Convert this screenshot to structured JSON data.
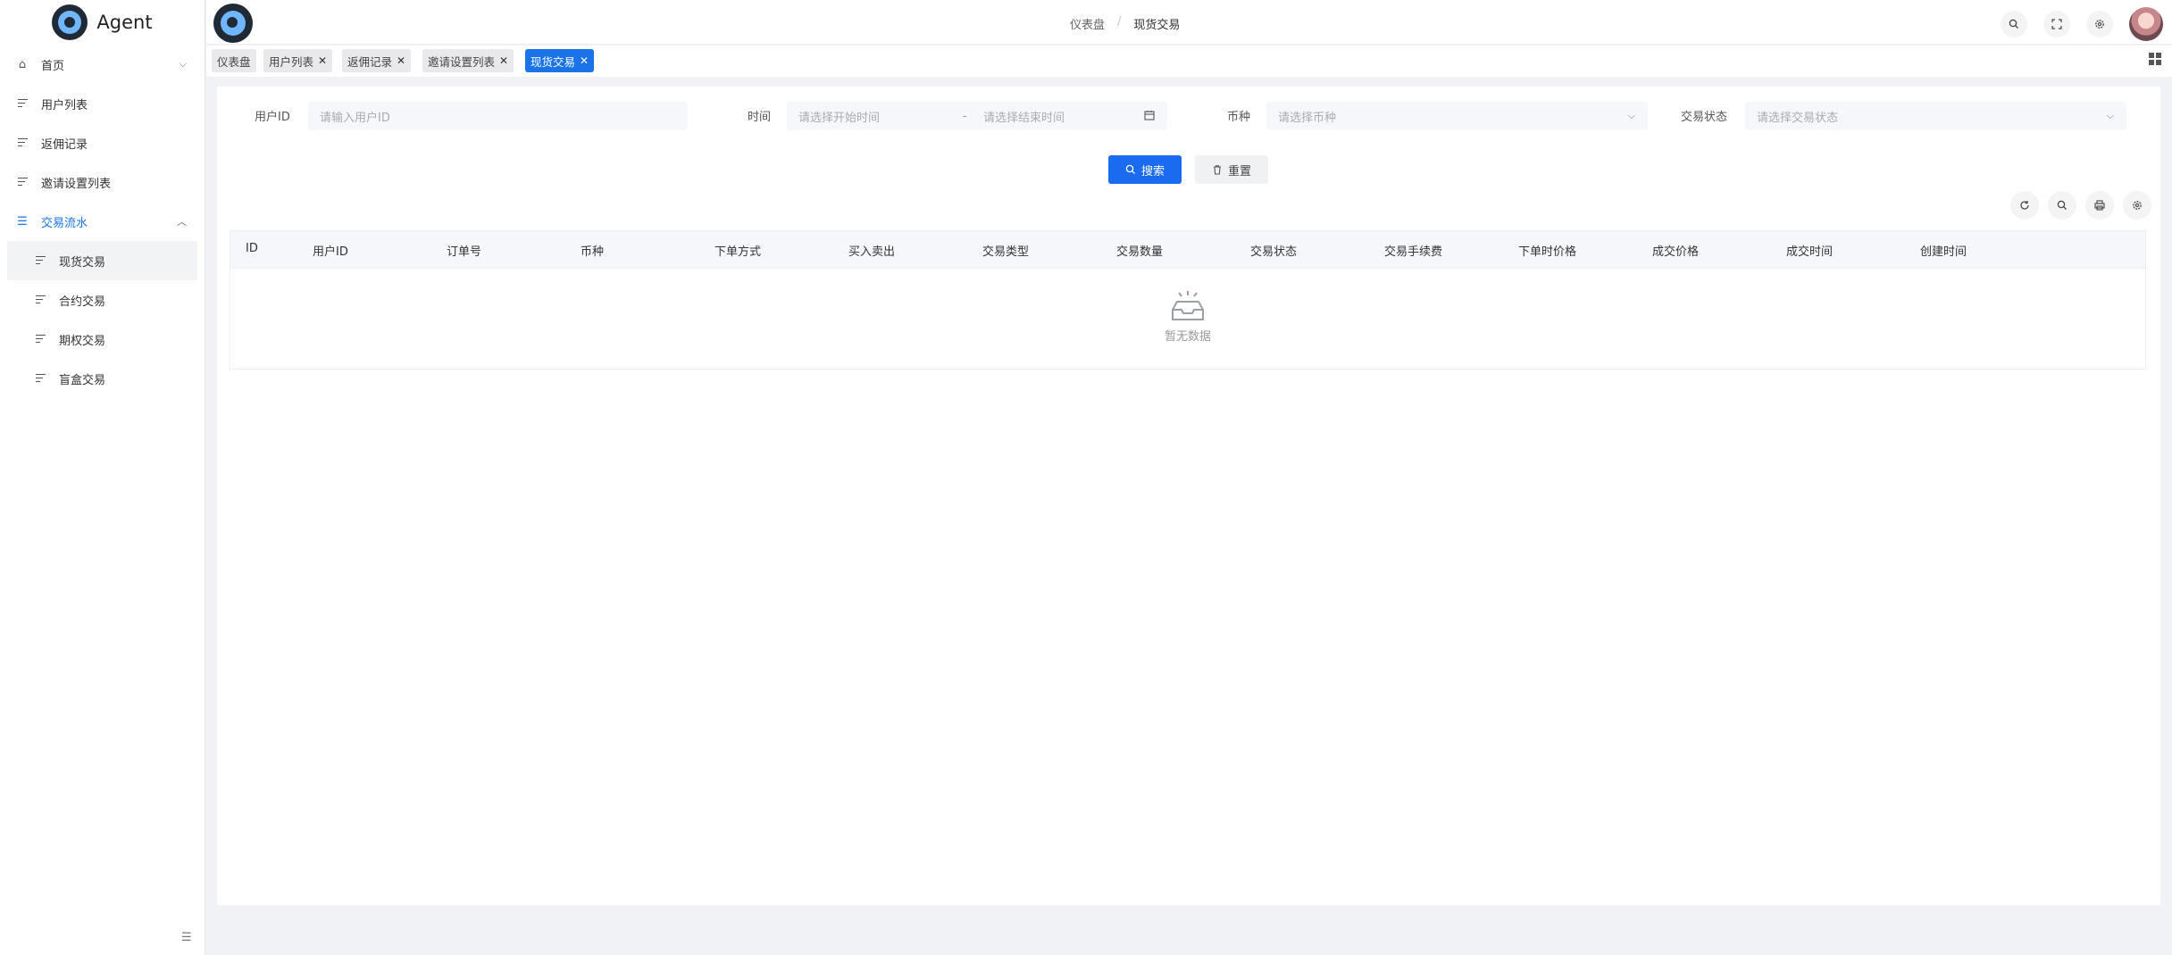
{
  "brand": {
    "name": "Agent"
  },
  "sidebar": {
    "items": [
      {
        "label": "首页",
        "icon": "home-icon",
        "chevron": "⌵"
      },
      {
        "label": "用户列表",
        "icon": "list-icon"
      },
      {
        "label": "返佣记录",
        "icon": "list-icon"
      },
      {
        "label": "邀请设置列表",
        "icon": "list-icon"
      },
      {
        "label": "交易流水",
        "icon": "menu-icon",
        "chevron": "︿"
      }
    ],
    "subitems": [
      {
        "label": "现货交易"
      },
      {
        "label": "合约交易"
      },
      {
        "label": "期权交易"
      },
      {
        "label": "盲盒交易"
      }
    ],
    "collapse_icon": "☰"
  },
  "header": {
    "breadcrumb": {
      "root": "仪表盘",
      "sep": "/",
      "current": "现货交易"
    }
  },
  "tags": [
    {
      "label": "仪表盘"
    },
    {
      "label": "用户列表",
      "close": "✕"
    },
    {
      "label": "返佣记录",
      "close": "✕"
    },
    {
      "label": "邀请设置列表",
      "close": "✕"
    },
    {
      "label": "现货交易",
      "close": "✕"
    }
  ],
  "filters": {
    "user_id": {
      "label": "用户ID",
      "placeholder": "请输入用户ID"
    },
    "time": {
      "label": "时间",
      "start_placeholder": "请选择开始时间",
      "sep": "-",
      "end_placeholder": "请选择结束时间"
    },
    "coin": {
      "label": "币种",
      "placeholder": "请选择币种"
    },
    "status": {
      "label": "交易状态",
      "placeholder": "请选择交易状态"
    }
  },
  "actions": {
    "search": "搜索",
    "reset": "重置"
  },
  "table": {
    "columns": [
      "ID",
      "用户ID",
      "订单号",
      "币种",
      "下单方式",
      "买入卖出",
      "交易类型",
      "交易数量",
      "交易状态",
      "交易手续费",
      "下单时价格",
      "成交价格",
      "成交时间",
      "创建时间"
    ],
    "empty_text": "暂无数据"
  },
  "colors": {
    "primary": "#1a6bf0",
    "active_menu": "#1a73e8"
  }
}
